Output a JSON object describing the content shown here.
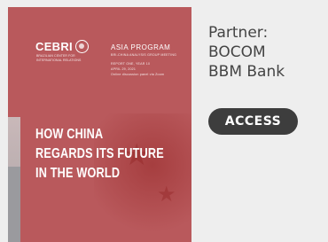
{
  "cover": {
    "logo_text": "CEBRI",
    "logo_subtitle": "BRAZILIAN CENTER FOR INTERNATIONAL RELATIONS",
    "program_title": "ASIA PROGRAM",
    "program_subtitle": "BRI-CHINA ANALYSIS GROUP MEETING",
    "program_meta_1": "REPORT ONE, YEAR 10",
    "program_meta_2": "APRIL 29, 2021",
    "program_meta_3": "Online discussion panel via Zoom",
    "headline_line_1": "HOW CHINA",
    "headline_line_2": "REGARDS ITS FUTURE",
    "headline_line_3": "IN THE WORLD",
    "colors": {
      "background": "#b9595c",
      "text": "#ffffff"
    }
  },
  "partner": {
    "line_1": "Partner:",
    "line_2": "BOCOM",
    "line_3": "BBM Bank"
  },
  "access_button": {
    "label": "ACCESS",
    "color": "#3d3d3d"
  }
}
